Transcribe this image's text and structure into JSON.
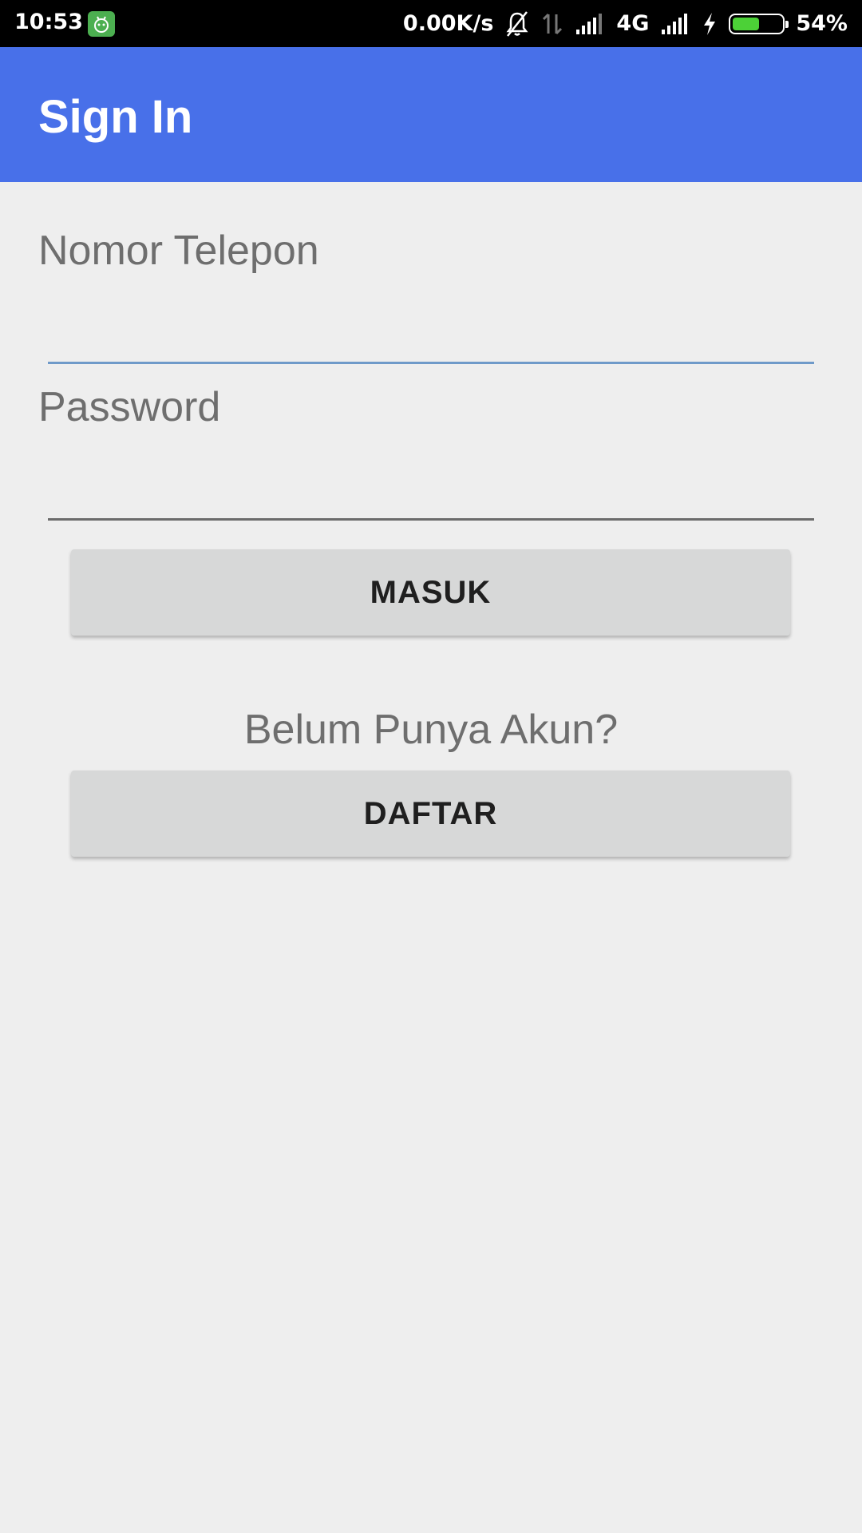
{
  "status_bar": {
    "time": "10:53",
    "network_speed": "0.00K/s",
    "network_type": "4G",
    "battery_percent": "54%",
    "battery_level": 0.54,
    "app_badge_icon": "android-icon",
    "icons": [
      "bell-off-icon",
      "data-arrows-icon",
      "signal-icon",
      "signal-icon",
      "charging-icon",
      "battery-icon"
    ],
    "battery_color": "#4cd137"
  },
  "app_bar": {
    "title": "Sign In",
    "color": "#4870e9"
  },
  "form": {
    "phone_label": "Nomor Telepon",
    "phone_value": "",
    "password_label": "Password",
    "password_value": "",
    "login_button": "MASUK",
    "register_prompt": "Belum Punya Akun?",
    "register_button": "DAFTAR"
  }
}
